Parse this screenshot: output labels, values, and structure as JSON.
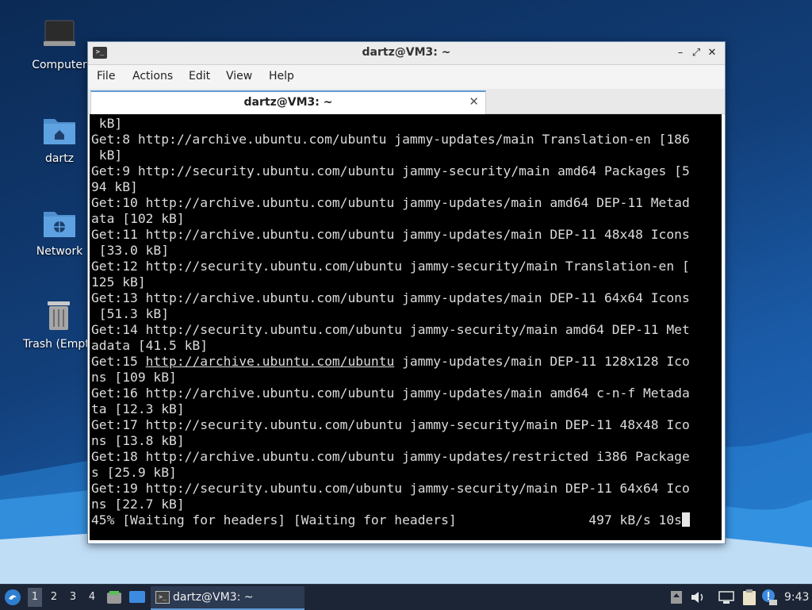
{
  "desktop": {
    "icons": [
      {
        "label": "Computer",
        "icon": "computer-icon"
      },
      {
        "label": "dartz",
        "icon": "home-folder-icon"
      },
      {
        "label": "Network",
        "icon": "network-folder-icon"
      },
      {
        "label": "Trash (Empty)",
        "icon": "trash-icon"
      }
    ]
  },
  "window": {
    "title": "dartz@VM3: ~",
    "controls": {
      "minimize": "–",
      "maximize": "⤢",
      "close": "✕"
    },
    "menu": [
      "File",
      "Actions",
      "Edit",
      "View",
      "Help"
    ],
    "tab": {
      "label": "dartz@VM3: ~",
      "close": "✕"
    }
  },
  "terminal": {
    "lines": [
      " kB]",
      "Get:8 http://archive.ubuntu.com/ubuntu jammy-updates/main Translation-en [186",
      " kB]",
      "Get:9 http://security.ubuntu.com/ubuntu jammy-security/main amd64 Packages [5",
      "94 kB]",
      "Get:10 http://archive.ubuntu.com/ubuntu jammy-updates/main amd64 DEP-11 Metad",
      "ata [102 kB]",
      "Get:11 http://archive.ubuntu.com/ubuntu jammy-updates/main DEP-11 48x48 Icons",
      " [33.0 kB]",
      "Get:12 http://security.ubuntu.com/ubuntu jammy-security/main Translation-en [",
      "125 kB]",
      "Get:13 http://archive.ubuntu.com/ubuntu jammy-updates/main DEP-11 64x64 Icons",
      " [51.3 kB]",
      "Get:14 http://security.ubuntu.com/ubuntu jammy-security/main amd64 DEP-11 Met",
      "adata [41.5 kB]",
      "Get:15 ",
      "ns [109 kB]",
      "Get:16 http://archive.ubuntu.com/ubuntu jammy-updates/main amd64 c-n-f Metada",
      "ta [12.3 kB]",
      "Get:17 http://security.ubuntu.com/ubuntu jammy-security/main DEP-11 48x48 Ico",
      "ns [13.8 kB]",
      "Get:18 http://archive.ubuntu.com/ubuntu jammy-updates/restricted i386 Package",
      "s [25.9 kB]",
      "Get:19 http://security.ubuntu.com/ubuntu jammy-security/main DEP-11 64x64 Ico",
      "ns [22.7 kB]",
      "45% [Waiting for headers] [Waiting for headers]                 497 kB/s 10s"
    ],
    "line15_link": "http://archive.ubuntu.com/ubuntu",
    "line15_rest": " jammy-updates/main DEP-11 128x128 Ico"
  },
  "taskbar": {
    "workspaces": [
      "1",
      "2",
      "3",
      "4"
    ],
    "active_workspace": "1",
    "task_title": "dartz@VM3: ~",
    "clock": "9:43"
  }
}
